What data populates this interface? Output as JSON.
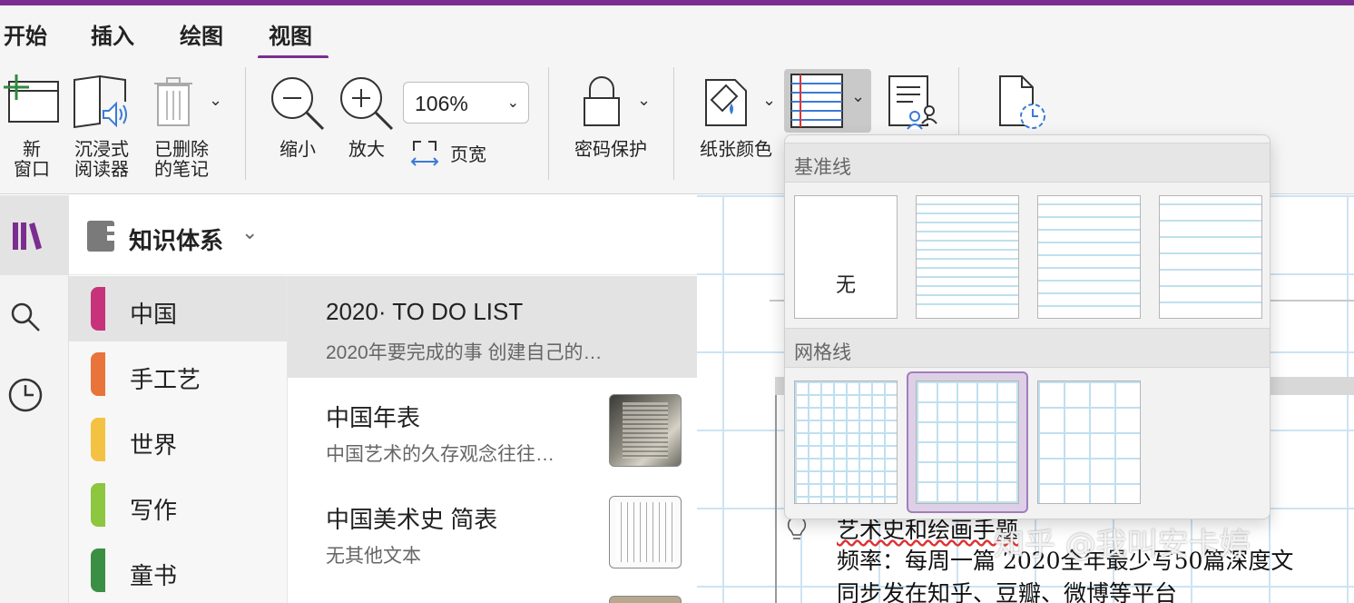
{
  "tabs": [
    "开始",
    "插入",
    "绘图",
    "视图"
  ],
  "active_tab": "视图",
  "ribbon": {
    "new_window": {
      "line1": "新",
      "line2": "窗口"
    },
    "reader": {
      "line1": "沉浸式",
      "line2": "阅读器"
    },
    "deleted": {
      "line1": "已删除",
      "line2": "的笔记"
    },
    "zoom_out": "缩小",
    "zoom_in": "放大",
    "zoom_value": "106%",
    "page_width": "页宽",
    "password": "密码保护",
    "paper_color": "纸张颜色"
  },
  "notebook": {
    "title": "知识体系"
  },
  "sections": [
    {
      "name": "中国",
      "color": "#c6337a"
    },
    {
      "name": "手工艺",
      "color": "#e8743b"
    },
    {
      "name": "世界",
      "color": "#f4c243"
    },
    {
      "name": "写作",
      "color": "#8dc63f"
    },
    {
      "name": "童书",
      "color": "#3a8f45"
    }
  ],
  "pages": [
    {
      "title": "2020· TO DO LIST",
      "subtitle": "2020年要完成的事  创建自己的…"
    },
    {
      "title": "中国年表",
      "subtitle": "中国艺术的久存观念往往…"
    },
    {
      "title": "中国美术史 简表",
      "subtitle": "无其他文本"
    }
  ],
  "popup": {
    "rule_header": "基准线",
    "none_label": "无",
    "grid_header": "网格线"
  },
  "canvas": {
    "line1": "艺术史和绘画手题",
    "line2": "频率：每周一篇  2020全年最少写50篇深度文",
    "line3": "同步发在知乎、豆瓣、微博等平台",
    "watermark": "知乎 @我叫安卡婷"
  },
  "colors": {
    "accent": "#7b2d91"
  }
}
